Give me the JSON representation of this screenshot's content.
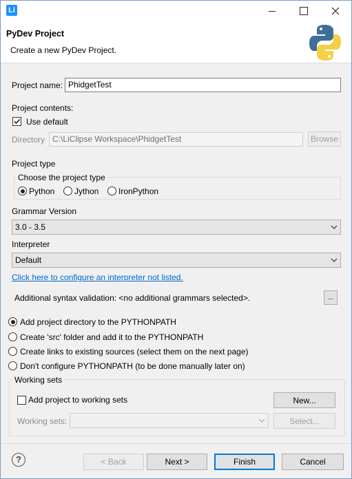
{
  "window": {
    "icon_text": "Li",
    "minimize_glyph": "—",
    "maximize_glyph": "☐",
    "close_glyph": "✕"
  },
  "header": {
    "title": "PyDev Project",
    "description": "Create a new PyDev Project."
  },
  "project_name": {
    "label": "Project name:",
    "value": "PhidgetTest"
  },
  "project_contents": {
    "label": "Project contents:",
    "use_default_label": "Use default",
    "use_default_checked": true,
    "directory_label": "Directory",
    "directory_value": "C:\\LiClipse Workspace\\PhidgetTest",
    "browse_label": "Browse"
  },
  "project_type": {
    "label": "Project type",
    "group_label": "Choose the project type",
    "options": [
      "Python",
      "Jython",
      "IronPython"
    ],
    "selected": "Python"
  },
  "grammar": {
    "label": "Grammar Version",
    "value": "3.0 - 3.5"
  },
  "interpreter": {
    "label": "Interpreter",
    "value": "Default",
    "configure_link": "Click here to configure an interpreter not listed."
  },
  "syntax_validation": {
    "text": "Additional syntax validation: <no additional grammars selected>.",
    "button_label": "..."
  },
  "pythonpath_options": [
    "Add project directory to the PYTHONPATH",
    "Create 'src' folder and add it to the PYTHONPATH",
    "Create links to existing sources (select them on the next page)",
    "Don't configure PYTHONPATH (to be done manually later on)"
  ],
  "pythonpath_selected_index": 0,
  "working_sets": {
    "group_label": "Working sets",
    "add_label": "Add project to working sets",
    "add_checked": false,
    "new_button": "New...",
    "sets_label": "Working sets:",
    "select_button": "Select..."
  },
  "footer": {
    "help_glyph": "?",
    "back": "< Back",
    "next": "Next >",
    "finish": "Finish",
    "cancel": "Cancel"
  },
  "colors": {
    "accent": "#0078d7",
    "link": "#0066cc",
    "python_blue": "#3f6f99",
    "python_yellow": "#f5cf45"
  }
}
